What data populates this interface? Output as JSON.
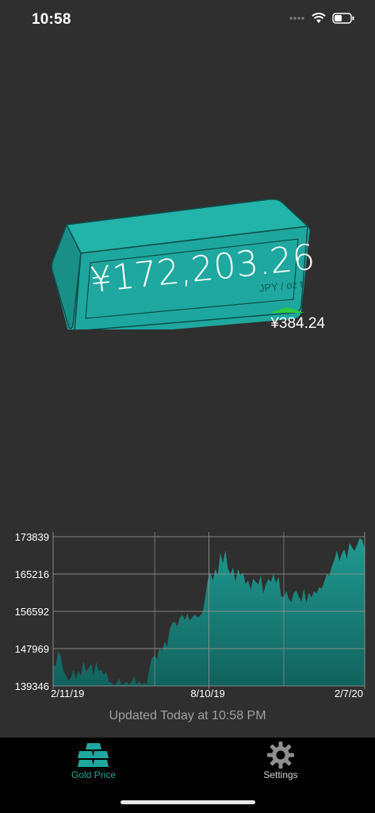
{
  "status_bar": {
    "time": "10:58"
  },
  "hero": {
    "price": "¥172,203.26",
    "unit": "JPY / oz t",
    "change": "¥384.24",
    "change_direction": "up"
  },
  "chart_data": {
    "type": "area",
    "y_ticks": [
      "173839",
      "165216",
      "156592",
      "147969",
      "139346"
    ],
    "x_ticks": [
      "2/11/19",
      "8/10/19",
      "2/7/20"
    ],
    "ylim": [
      139346,
      173839
    ],
    "grid": true,
    "color": "#1a8f87",
    "values": [
      144200,
      143800,
      147400,
      146200,
      142800,
      141800,
      140600,
      141200,
      143100,
      140900,
      142900,
      141700,
      145100,
      142700,
      143300,
      144600,
      141800,
      144800,
      142800,
      143100,
      141900,
      142600,
      140300,
      140100,
      139600,
      139800,
      141100,
      139600,
      139900,
      140300,
      139700,
      140300,
      141700,
      139800,
      140400,
      139600,
      140100,
      139600,
      143400,
      145700,
      146400,
      145600,
      148300,
      147400,
      149600,
      148500,
      152300,
      153900,
      154200,
      153100,
      155100,
      155800,
      154600,
      156100,
      154400,
      155300,
      155900,
      155200,
      155600,
      156300,
      159600,
      163600,
      165700,
      163600,
      166400,
      164900,
      170100,
      167600,
      170700,
      166400,
      165200,
      166700,
      163400,
      166300,
      164900,
      165500,
      162900,
      163800,
      161500,
      164200,
      163400,
      162800,
      164900,
      160700,
      162900,
      164100,
      163400,
      165300,
      163100,
      164600,
      160100,
      159800,
      161300,
      159600,
      158700,
      160800,
      161400,
      159900,
      158900,
      161800,
      158600,
      160900,
      159700,
      161300,
      160700,
      162200,
      161800,
      163400,
      165200,
      164800,
      166900,
      168400,
      170700,
      168100,
      169900,
      170900,
      168700,
      172400,
      171400,
      170600,
      171900,
      173500,
      173100,
      171000
    ]
  },
  "footer": {
    "updated": "Updated Today at 10:58 PM"
  },
  "tabs": [
    {
      "label": "Gold Price",
      "active": true
    },
    {
      "label": "Settings",
      "active": false
    }
  ],
  "colors": {
    "accent": "#1ea79e",
    "background": "#2f2f2f",
    "up": "#2ecc40"
  }
}
